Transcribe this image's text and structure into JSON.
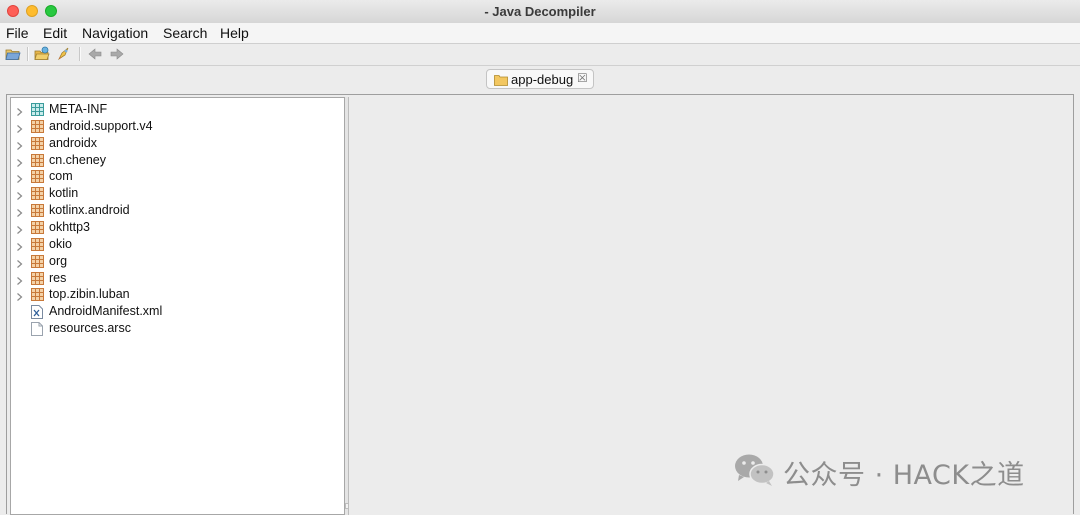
{
  "window": {
    "title": "- Java Decompiler"
  },
  "menu": {
    "file": "File",
    "edit": "Edit",
    "navigation": "Navigation",
    "search": "Search",
    "help": "Help"
  },
  "toolbar": {
    "icons": [
      "open-file-icon",
      "open-type-icon",
      "launch-icon",
      "back-arrow-icon",
      "forward-arrow-icon"
    ]
  },
  "tab": {
    "label": "app-debug",
    "close": "☒"
  },
  "tree": {
    "items": [
      {
        "label": "META-INF",
        "icon": "package-teal-icon",
        "expandable": true
      },
      {
        "label": "android.support.v4",
        "icon": "package-icon",
        "expandable": true
      },
      {
        "label": "androidx",
        "icon": "package-icon",
        "expandable": true
      },
      {
        "label": "cn.cheney",
        "icon": "package-icon",
        "expandable": true
      },
      {
        "label": "com",
        "icon": "package-icon",
        "expandable": true
      },
      {
        "label": "kotlin",
        "icon": "package-icon",
        "expandable": true
      },
      {
        "label": "kotlinx.android",
        "icon": "package-icon",
        "expandable": true
      },
      {
        "label": "okhttp3",
        "icon": "package-icon",
        "expandable": true
      },
      {
        "label": "okio",
        "icon": "package-icon",
        "expandable": true
      },
      {
        "label": "org",
        "icon": "package-icon",
        "expandable": true
      },
      {
        "label": "res",
        "icon": "package-icon",
        "expandable": true
      },
      {
        "label": "top.zibin.luban",
        "icon": "package-icon",
        "expandable": true
      },
      {
        "label": "AndroidManifest.xml",
        "icon": "xml-file-icon",
        "expandable": false
      },
      {
        "label": "resources.arsc",
        "icon": "file-icon",
        "expandable": false
      }
    ]
  },
  "watermark": {
    "text": "公众号 · HACK之道"
  },
  "colors": {
    "close": "#fe5f57",
    "minimize": "#febc2e",
    "maximize": "#28c840",
    "package": "#c8793a",
    "package_teal": "#3a9c9c"
  }
}
